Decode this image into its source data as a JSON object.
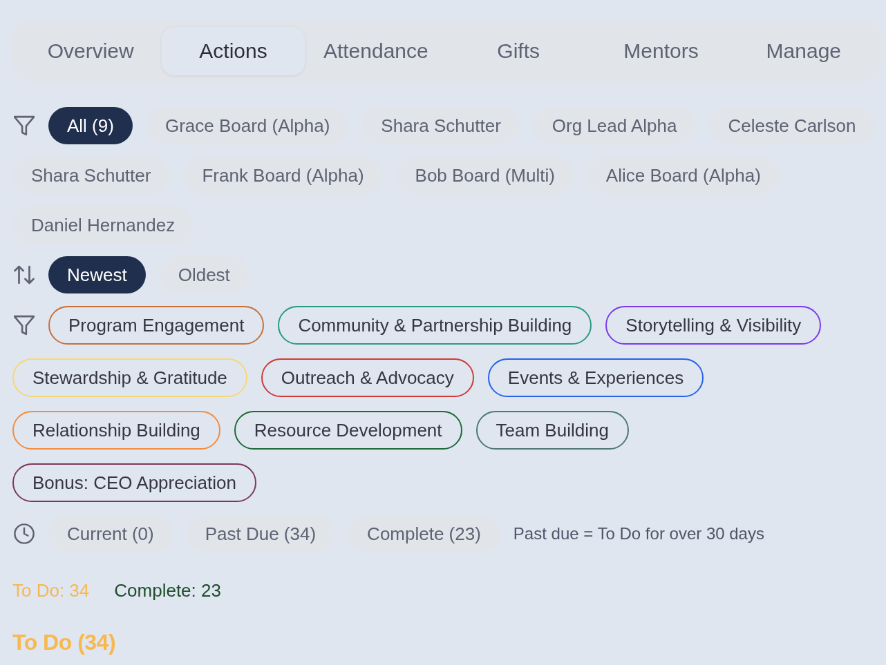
{
  "tabs": [
    {
      "label": "Overview",
      "selected": false
    },
    {
      "label": "Actions",
      "selected": true
    },
    {
      "label": "Attendance",
      "selected": false
    },
    {
      "label": "Gifts",
      "selected": false
    },
    {
      "label": "Mentors",
      "selected": false
    },
    {
      "label": "Manage",
      "selected": false
    }
  ],
  "person_filter": {
    "chips": [
      {
        "label": "All (9)",
        "selected": true
      },
      {
        "label": "Grace Board (Alpha)",
        "selected": false
      },
      {
        "label": "Shara Schutter",
        "selected": false
      },
      {
        "label": "Org Lead Alpha",
        "selected": false
      },
      {
        "label": "Celeste Carlson",
        "selected": false
      },
      {
        "label": "Shara Schutter",
        "selected": false
      },
      {
        "label": "Frank Board (Alpha)",
        "selected": false
      },
      {
        "label": "Bob Board (Multi)",
        "selected": false
      },
      {
        "label": "Alice Board (Alpha)",
        "selected": false
      },
      {
        "label": "Daniel Hernandez",
        "selected": false
      }
    ]
  },
  "sort": {
    "options": [
      {
        "label": "Newest",
        "selected": true
      },
      {
        "label": "Oldest",
        "selected": false
      }
    ]
  },
  "category_filter": {
    "chips": [
      {
        "label": "Program Engagement",
        "color": "#c8703a",
        "selected": false
      },
      {
        "label": "Community & Partnership Building",
        "color": "#2a9a82",
        "selected": false
      },
      {
        "label": "Storytelling & Visibility",
        "color": "#7c3aed",
        "selected": false
      },
      {
        "label": "Stewardship & Gratitude",
        "color": "#f7d774",
        "selected": false
      },
      {
        "label": "Outreach & Advocacy",
        "color": "#d03a3a",
        "selected": false
      },
      {
        "label": "Events & Experiences",
        "color": "#2563eb",
        "selected": false
      },
      {
        "label": "Relationship Building",
        "color": "#f58c3c",
        "selected": false
      },
      {
        "label": "Resource Development",
        "color": "#1e6b36",
        "selected": false
      },
      {
        "label": "Team Building",
        "color": "#4d7878",
        "selected": false
      },
      {
        "label": "Bonus: CEO Appreciation",
        "color": "#7a3a5a",
        "selected": false
      }
    ]
  },
  "status_filter": {
    "chips": [
      {
        "label": "Current (0)",
        "selected": false
      },
      {
        "label": "Past Due (34)",
        "selected": false
      },
      {
        "label": "Complete (23)",
        "selected": false
      }
    ],
    "note": "Past due = To Do for over 30 days"
  },
  "summary": [
    {
      "label": "To Do: 34",
      "color": "#f7b84f"
    },
    {
      "label": "Complete: 23",
      "color": "#1f4d2a"
    }
  ],
  "section_heading": "To Do (34)"
}
